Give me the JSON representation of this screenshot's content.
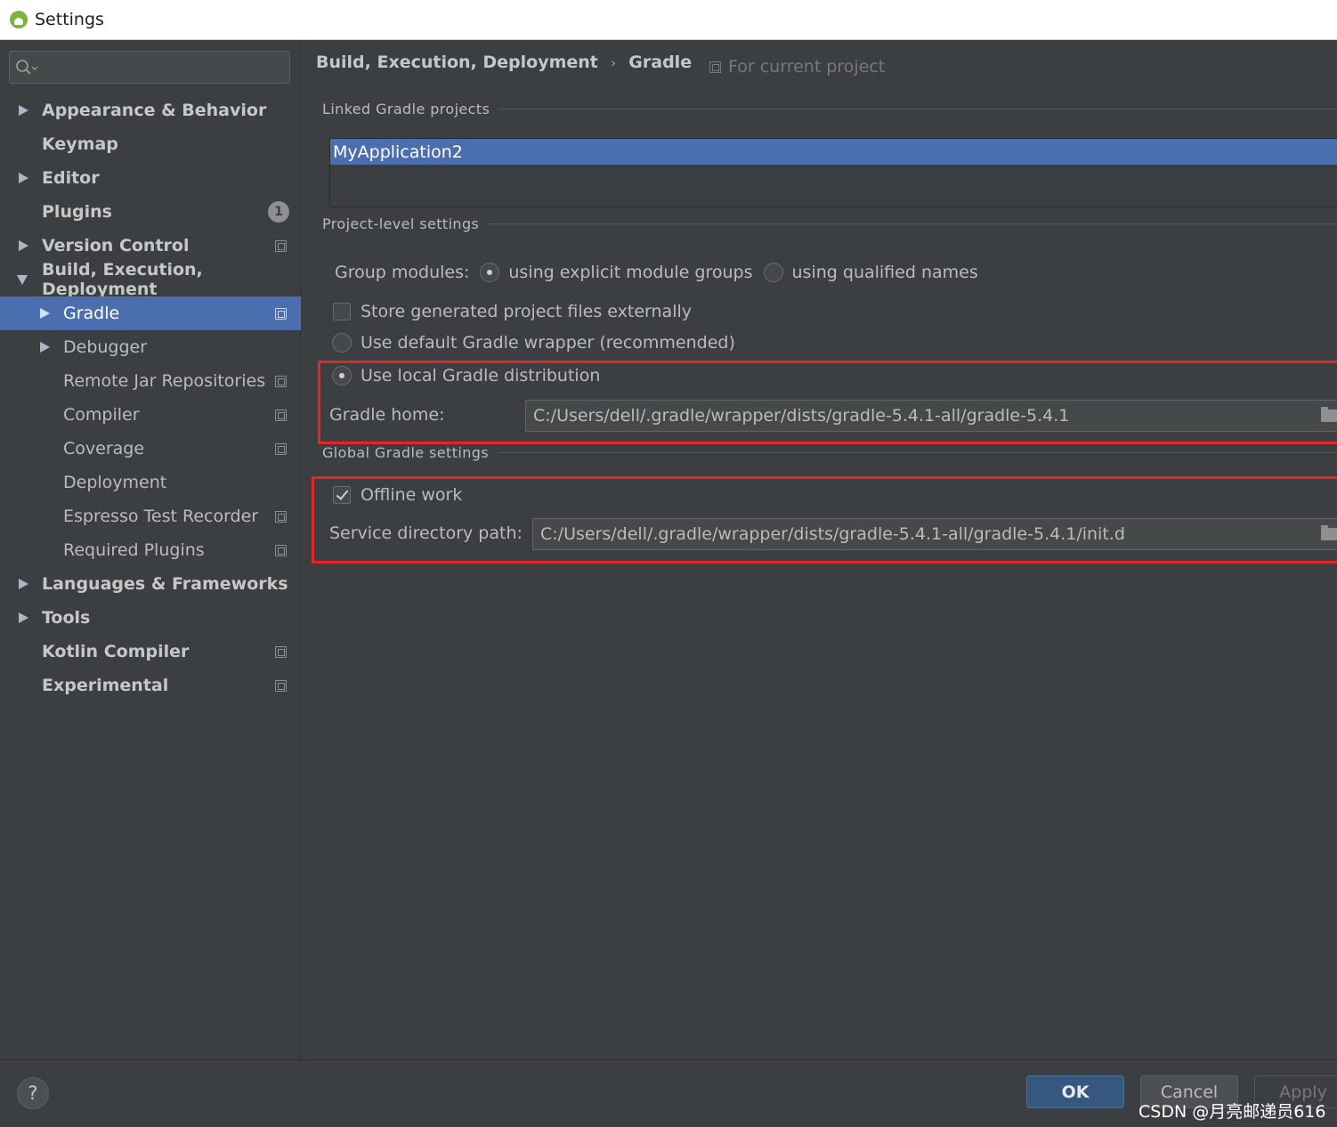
{
  "window": {
    "title": "Settings"
  },
  "sidebar": {
    "search_placeholder": "",
    "items": [
      {
        "label": "Appearance & Behavior"
      },
      {
        "label": "Keymap"
      },
      {
        "label": "Editor"
      },
      {
        "label": "Plugins",
        "badge": "1"
      },
      {
        "label": "Version Control"
      },
      {
        "label": "Build, Execution, Deployment"
      },
      {
        "label": "Gradle"
      },
      {
        "label": "Debugger"
      },
      {
        "label": "Remote Jar Repositories"
      },
      {
        "label": "Compiler"
      },
      {
        "label": "Coverage"
      },
      {
        "label": "Deployment"
      },
      {
        "label": "Espresso Test Recorder"
      },
      {
        "label": "Required Plugins"
      },
      {
        "label": "Languages & Frameworks"
      },
      {
        "label": "Tools"
      },
      {
        "label": "Kotlin Compiler"
      },
      {
        "label": "Experimental"
      }
    ]
  },
  "main": {
    "breadcrumb": [
      "Build, Execution, Deployment",
      "Gradle"
    ],
    "breadcrumb_separator": "›",
    "for_current_project": "For current project",
    "linked_projects": {
      "title": "Linked Gradle projects",
      "items": [
        "MyApplication2"
      ]
    },
    "project_settings": {
      "title": "Project-level settings",
      "group_modules_label": "Group modules:",
      "group_modules_options": [
        "using explicit module groups",
        "using qualified names"
      ],
      "group_modules_selected": "using explicit module groups",
      "store_externally": {
        "label": "Store generated project files externally",
        "checked": false
      },
      "use_default_wrapper": {
        "label": "Use default Gradle wrapper (recommended)",
        "selected": false
      },
      "use_local_distribution": {
        "label": "Use local Gradle distribution",
        "selected": true
      },
      "gradle_home": {
        "label": "Gradle home:",
        "value": "C:/Users/dell/.gradle/wrapper/dists/gradle-5.4.1-all/gradle-5.4.1"
      }
    },
    "global_settings": {
      "title": "Global Gradle settings",
      "offline_work": {
        "label": "Offline work",
        "checked": true
      },
      "service_directory": {
        "label": "Service directory path:",
        "value": "C:/Users/dell/.gradle/wrapper/dists/gradle-5.4.1-all/gradle-5.4.1/init.d"
      }
    }
  },
  "footer": {
    "help_label": "?",
    "ok_label": "OK",
    "cancel_label": "Cancel",
    "apply_label": "Apply",
    "watermark": "CSDN @月亮邮递员616"
  },
  "colors": {
    "selection": "#4b6eaf",
    "highlight_box": "#e5242c",
    "background": "#3c3f41"
  }
}
